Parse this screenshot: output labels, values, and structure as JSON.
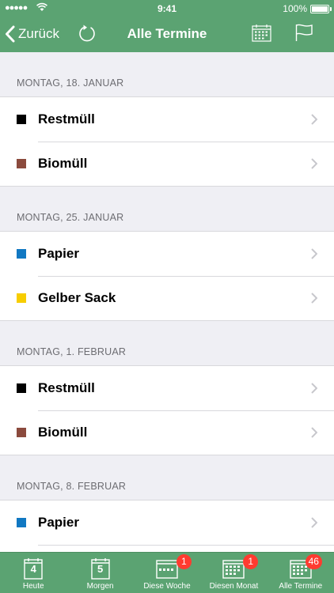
{
  "status_bar": {
    "signal": "●●●●●",
    "time": "9:41",
    "battery": "100%"
  },
  "nav": {
    "back_label": "Zurück",
    "title": "Alle Termine"
  },
  "colors": {
    "brand_green": "#5ba372",
    "restmuell": "#000000",
    "biomuell": "#8b4a3d",
    "papier": "#1178c2",
    "gelber_sack": "#f7cd00",
    "badge": "#ff3b30"
  },
  "sections": [
    {
      "header": "MONTAG, 18. JANUAR",
      "items": [
        {
          "label": "Restmüll",
          "color": "#000000"
        },
        {
          "label": "Biomüll",
          "color": "#8b4a3d"
        }
      ]
    },
    {
      "header": "MONTAG, 25. JANUAR",
      "items": [
        {
          "label": "Papier",
          "color": "#1178c2"
        },
        {
          "label": "Gelber Sack",
          "color": "#f7cd00"
        }
      ]
    },
    {
      "header": "MONTAG, 1. FEBRUAR",
      "items": [
        {
          "label": "Restmüll",
          "color": "#000000"
        },
        {
          "label": "Biomüll",
          "color": "#8b4a3d"
        }
      ]
    },
    {
      "header": "MONTAG, 8. FEBRUAR",
      "items": [
        {
          "label": "Papier",
          "color": "#1178c2"
        },
        {
          "label": "",
          "color": ""
        }
      ]
    }
  ],
  "tabs": [
    {
      "label": "Heute",
      "icon": "calendar-day-icon",
      "number": "4"
    },
    {
      "label": "Morgen",
      "icon": "calendar-day-icon",
      "number": "5"
    },
    {
      "label": "Diese Woche",
      "icon": "calendar-week-icon",
      "badge": "1"
    },
    {
      "label": "Diesen Monat",
      "icon": "calendar-month-icon",
      "badge": "1"
    },
    {
      "label": "Alle Termine",
      "icon": "calendar-all-icon",
      "badge": "46",
      "selected": true
    }
  ]
}
